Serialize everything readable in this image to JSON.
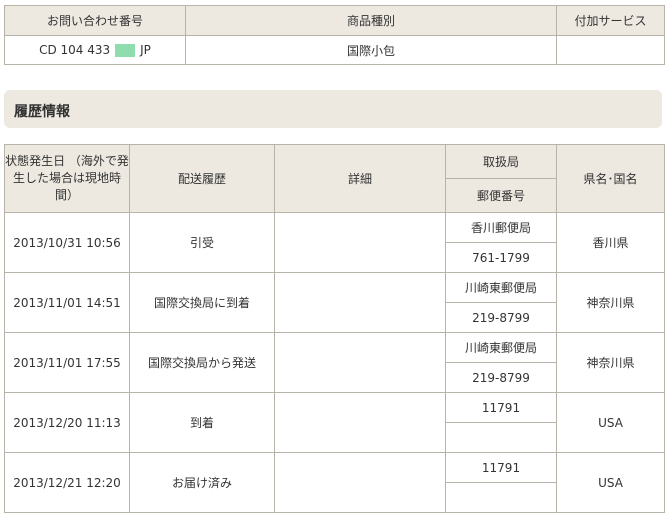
{
  "summary": {
    "headers": [
      "お問い合わせ番号",
      "商品種別",
      "付加サービス"
    ],
    "tracking_number_prefix": "CD 104 433",
    "tracking_number_suffix": "JP",
    "product_type": "国際小包",
    "additional_service": ""
  },
  "section_title": "履歴情報",
  "history": {
    "headers": {
      "status_date": "状態発生日 （海外で発生した場合は現地時間）",
      "delivery_history": "配送履歴",
      "details": "詳細",
      "office": "取扱局",
      "postal_code": "郵便番号",
      "region": "県名･国名"
    },
    "rows": [
      {
        "date": "2013/10/31 10:56",
        "event": "引受",
        "detail": "",
        "office": "香川郵便局",
        "postal": "761-1799",
        "region": "香川県"
      },
      {
        "date": "2013/11/01 14:51",
        "event": "国際交換局に到着",
        "detail": "",
        "office": "川崎東郵便局",
        "postal": "219-8799",
        "region": "神奈川県"
      },
      {
        "date": "2013/11/01 17:55",
        "event": "国際交換局から発送",
        "detail": "",
        "office": "川崎東郵便局",
        "postal": "219-8799",
        "region": "神奈川県"
      },
      {
        "date": "2013/12/20 11:13",
        "event": "到着",
        "detail": "",
        "office": "11791",
        "postal": "",
        "region": "USA"
      },
      {
        "date": "2013/12/21 12:20",
        "event": "お届け済み",
        "detail": "",
        "office": "11791",
        "postal": "",
        "region": "USA"
      }
    ]
  }
}
